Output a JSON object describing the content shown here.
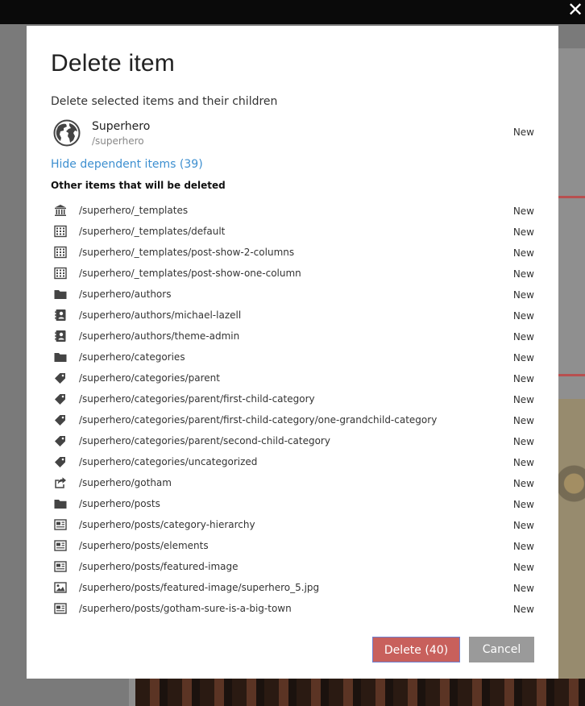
{
  "dialog": {
    "title": "Delete item",
    "subtitle": "Delete selected items and their children",
    "selected_item": {
      "name": "Superhero",
      "path": "/superhero",
      "status": "New",
      "icon": "globe-icon"
    },
    "toggle_link": "Hide dependent items (39)",
    "other_heading": "Other items that will be deleted",
    "items": [
      {
        "path": "/superhero/_templates",
        "status": "New",
        "icon": "bank-icon"
      },
      {
        "path": "/superhero/_templates/default",
        "status": "New",
        "icon": "layout-icon"
      },
      {
        "path": "/superhero/_templates/post-show-2-columns",
        "status": "New",
        "icon": "layout-icon"
      },
      {
        "path": "/superhero/_templates/post-show-one-column",
        "status": "New",
        "icon": "layout-icon"
      },
      {
        "path": "/superhero/authors",
        "status": "New",
        "icon": "folder-icon"
      },
      {
        "path": "/superhero/authors/michael-lazell",
        "status": "New",
        "icon": "contact-icon"
      },
      {
        "path": "/superhero/authors/theme-admin",
        "status": "New",
        "icon": "contact-icon"
      },
      {
        "path": "/superhero/categories",
        "status": "New",
        "icon": "folder-icon"
      },
      {
        "path": "/superhero/categories/parent",
        "status": "New",
        "icon": "tag-icon"
      },
      {
        "path": "/superhero/categories/parent/first-child-category",
        "status": "New",
        "icon": "tag-icon"
      },
      {
        "path": "/superhero/categories/parent/first-child-category/one-grandchild-category",
        "status": "New",
        "icon": "tag-icon"
      },
      {
        "path": "/superhero/categories/parent/second-child-category",
        "status": "New",
        "icon": "tag-icon"
      },
      {
        "path": "/superhero/categories/uncategorized",
        "status": "New",
        "icon": "tag-icon"
      },
      {
        "path": "/superhero/gotham",
        "status": "New",
        "icon": "share-icon"
      },
      {
        "path": "/superhero/posts",
        "status": "New",
        "icon": "folder-icon"
      },
      {
        "path": "/superhero/posts/category-hierarchy",
        "status": "New",
        "icon": "article-icon"
      },
      {
        "path": "/superhero/posts/elements",
        "status": "New",
        "icon": "article-icon"
      },
      {
        "path": "/superhero/posts/featured-image",
        "status": "New",
        "icon": "article-icon"
      },
      {
        "path": "/superhero/posts/featured-image/superhero_5.jpg",
        "status": "New",
        "icon": "image-icon"
      },
      {
        "path": "/superhero/posts/gotham-sure-is-a-big-town",
        "status": "New",
        "icon": "article-icon"
      }
    ],
    "buttons": {
      "delete": "Delete (40)",
      "cancel": "Cancel"
    }
  },
  "colors": {
    "delete_button": "#c8605c",
    "cancel_button": "#9a9a9a",
    "link": "#3d8fd0"
  }
}
